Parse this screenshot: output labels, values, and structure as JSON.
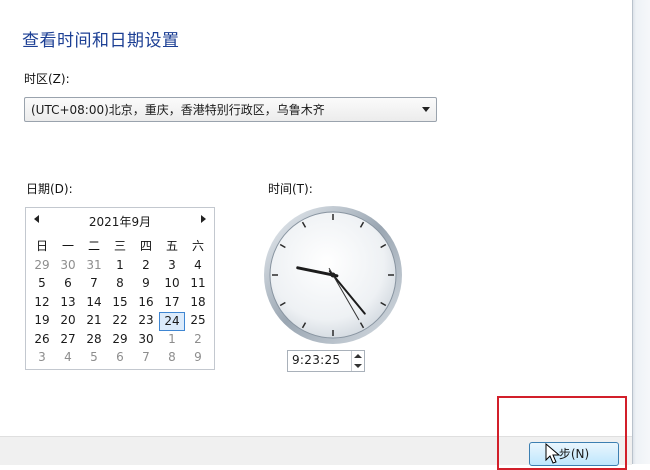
{
  "dialog": {
    "title": "查看时间和日期设置",
    "timezone_label": "时区(Z):",
    "timezone_value": "(UTC+08:00)北京，重庆，香港特别行政区，乌鲁木齐",
    "date_label": "日期(D):",
    "time_label": "时间(T):"
  },
  "calendar": {
    "month_label": "2021年9月",
    "weekdays": [
      "日",
      "一",
      "二",
      "三",
      "四",
      "五",
      "六"
    ],
    "weeks": [
      [
        "29",
        "30",
        "31",
        "1",
        "2",
        "3",
        "4"
      ],
      [
        "5",
        "6",
        "7",
        "8",
        "9",
        "10",
        "11"
      ],
      [
        "12",
        "13",
        "14",
        "15",
        "16",
        "17",
        "18"
      ],
      [
        "19",
        "20",
        "21",
        "22",
        "23",
        "24",
        "25"
      ],
      [
        "26",
        "27",
        "28",
        "29",
        "30",
        "1",
        "2"
      ],
      [
        "3",
        "4",
        "5",
        "6",
        "7",
        "8",
        "9"
      ]
    ],
    "selected_day": "24"
  },
  "time": {
    "value": "9:23:25",
    "hour": 9,
    "minute": 23,
    "second": 25
  },
  "footer": {
    "ok_label": "步(N)"
  },
  "colors": {
    "title": "#1c3f94",
    "highlight_box": "#d21f2a",
    "selected_day_border": "#3f86d2"
  }
}
